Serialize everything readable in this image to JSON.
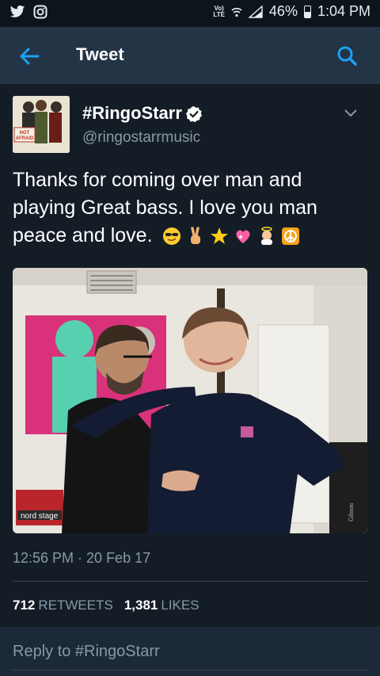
{
  "status_bar": {
    "left_icons": [
      "twitter-bird-icon",
      "instagram-icon"
    ],
    "network": "LTE",
    "battery": "46%",
    "time": "1:04 PM"
  },
  "app_bar": {
    "title": "Tweet",
    "back_icon": "arrow-left-icon",
    "search_icon": "search-icon",
    "accent": "#1da1f2"
  },
  "tweet": {
    "display_name": "#RingoStarr",
    "handle": "@ringostarrmusic",
    "avatar_sign_text": "NOT AFRAID",
    "text": "Thanks for coming over man and playing  Great bass. I love you man peace and love.",
    "emojis": [
      "cool-face-emoji",
      "victory-hand-emoji",
      "star-emoji",
      "sparkling-heart-emoji",
      "angel-emoji",
      "peace-symbol-emoji"
    ],
    "photo_keyboard_label": "nord stage",
    "photo_guitar_label": "Gibson",
    "timestamp": "12:56 PM · 20 Feb 17"
  },
  "stats": {
    "retweets_count": "712",
    "retweets_label": "RETWEETS",
    "likes_count": "1,381",
    "likes_label": "LIKES"
  },
  "reply": {
    "placeholder": "Reply to #RingoStarr"
  },
  "colors": {
    "background": "#141d26",
    "app_bar": "#243447",
    "secondary_text": "#8899a6",
    "verified": "#ffffff"
  }
}
